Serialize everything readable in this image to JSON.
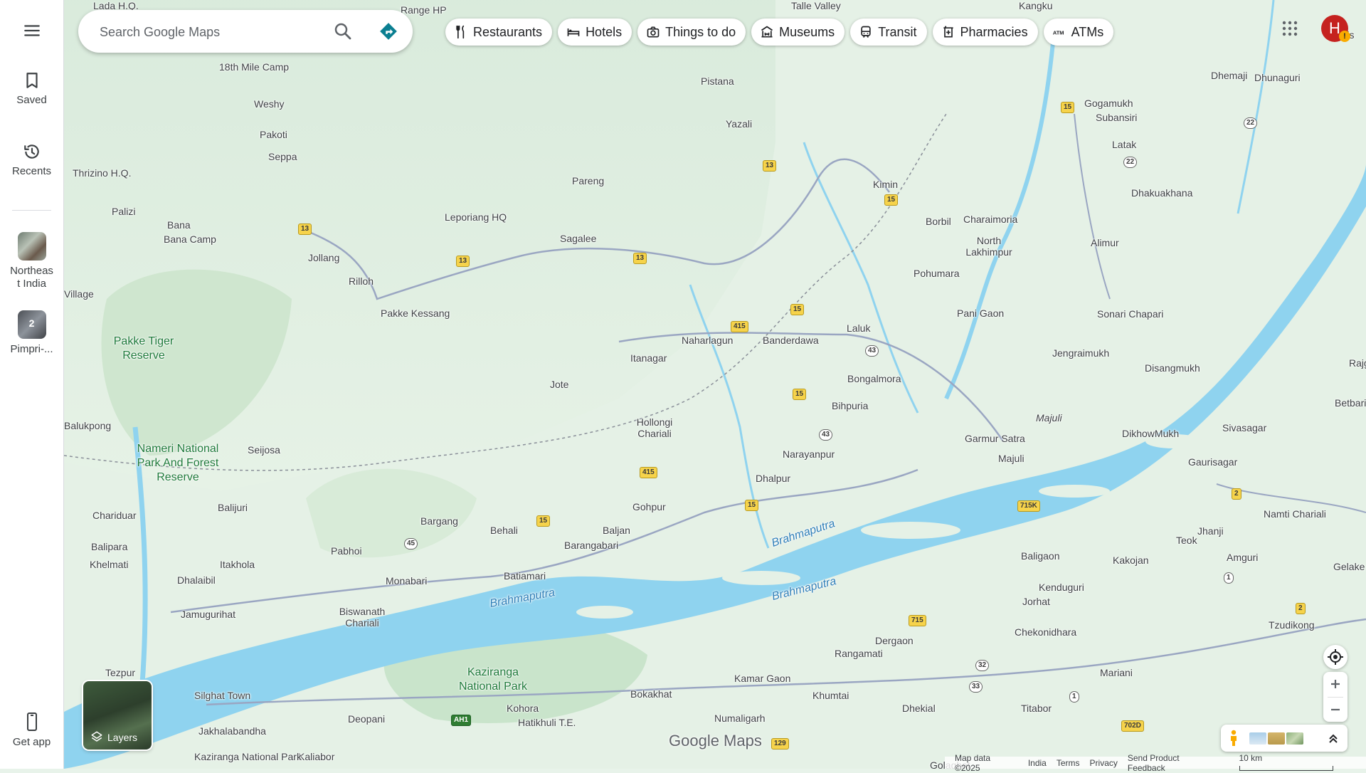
{
  "search": {
    "placeholder": "Search Google Maps"
  },
  "rail": {
    "saved": "Saved",
    "recents": "Recents",
    "recent_places": [
      {
        "label_line1": "Northeas",
        "label_line2": "t India"
      },
      {
        "label": "Pimpri-...",
        "count": "2"
      }
    ],
    "get_app": "Get app"
  },
  "chips": [
    {
      "label": "Restaurants",
      "icon": "fork-knife-icon"
    },
    {
      "label": "Hotels",
      "icon": "bed-icon"
    },
    {
      "label": "Things to do",
      "icon": "camera-icon"
    },
    {
      "label": "Museums",
      "icon": "museum-icon"
    },
    {
      "label": "Transit",
      "icon": "train-icon"
    },
    {
      "label": "Pharmacies",
      "icon": "pharmacy-icon"
    },
    {
      "label": "ATMs",
      "icon": "atm-icon"
    }
  ],
  "account": {
    "initial": "H",
    "badge": "!"
  },
  "layers": {
    "label": "Layers"
  },
  "watermark": "Google Maps",
  "footer": {
    "map_data": "Map data ©2025",
    "country": "India",
    "terms": "Terms",
    "privacy": "Privacy",
    "feedback": "Send Product Feedback",
    "scale": "10 km"
  },
  "map": {
    "places": [
      "Lada H.Q.",
      "Range HP",
      "Talle Valley",
      "Kangku",
      "18th Mile Camp",
      "Weshy",
      "Pakoti",
      "Seppa",
      "Thrizino H.Q.",
      "Palizi",
      "Bana",
      "Bana Camp",
      "Jollang",
      "Rilloh",
      "Pakke Kessang",
      "Pistana",
      "Yazali",
      "Pareng",
      "Leporiang HQ",
      "Sagalee",
      "Kimin",
      "Borbil",
      "Charaimoria",
      "North Lakhimpur",
      "Alimur",
      "Dhakuakhana",
      "Gogamukh",
      "Subansiri",
      "Latak",
      "Dhemaji",
      "Dhunaguri",
      "Pohumara",
      "Pani Gaon",
      "Sonari Chapari",
      "Naharlagun",
      "Banderdawa",
      "Laluk",
      "Itanagar",
      "Jote",
      "Bongalmora",
      "Bihpuria",
      "Jengraimukh",
      "Disangmukh",
      "Hollongi Chariali",
      "Majuli",
      "Garmur Satra",
      "Narayanpur",
      "Dhalpur",
      "DikhowMukh",
      "Sivasagar",
      "Gaurisagar",
      "Seijosa",
      "Balukpong",
      "Balijuri",
      "Chariduar",
      "Balipara",
      "Khelmati",
      "Bargang",
      "Behali",
      "Barangabari",
      "Baljan",
      "Gohpur",
      "Pabhoi",
      "Itakhola",
      "Dhalaibil",
      "Monabari",
      "Batiamari",
      "Jamugurihat",
      "Biswanath Chariali",
      "Baligaon",
      "Kakojan",
      "Teok",
      "Jhanji",
      "Amguri",
      "Namti Chariali",
      "Kenduguri",
      "Jorhat",
      "Chekonidhara",
      "Tzudikong",
      "Rangamati",
      "Dergaon",
      "Mariani",
      "Kamar Gaon",
      "Khumtai",
      "Dhekial",
      "Titabor",
      "Bokakhat",
      "Numaligarh",
      "Kohora",
      "Hatikhuli T.E.",
      "Tezpur",
      "Silghat Town",
      "Deopani",
      "Jakhalabandha",
      "Kaliabor",
      "Golaghat",
      "Gelake",
      "Betbari",
      "Rajg",
      "Sis",
      "Village",
      "Kaziranga National Park"
    ],
    "parks": [
      "Pakke Tiger Reserve",
      "Nameri National Park And Forest Reserve",
      "Kaziranga National Park"
    ],
    "rivers": [
      "Brahmaputra",
      "Brahmaputra",
      "Brahmaputra",
      "Majuli"
    ],
    "highways": [
      "13",
      "13",
      "13",
      "13",
      "15",
      "15",
      "15",
      "15",
      "15",
      "15",
      "415",
      "415",
      "43",
      "43",
      "45",
      "22",
      "22",
      "2",
      "2",
      "1",
      "1",
      "715",
      "715K",
      "32",
      "33",
      "129",
      "702D",
      "AH1"
    ]
  }
}
